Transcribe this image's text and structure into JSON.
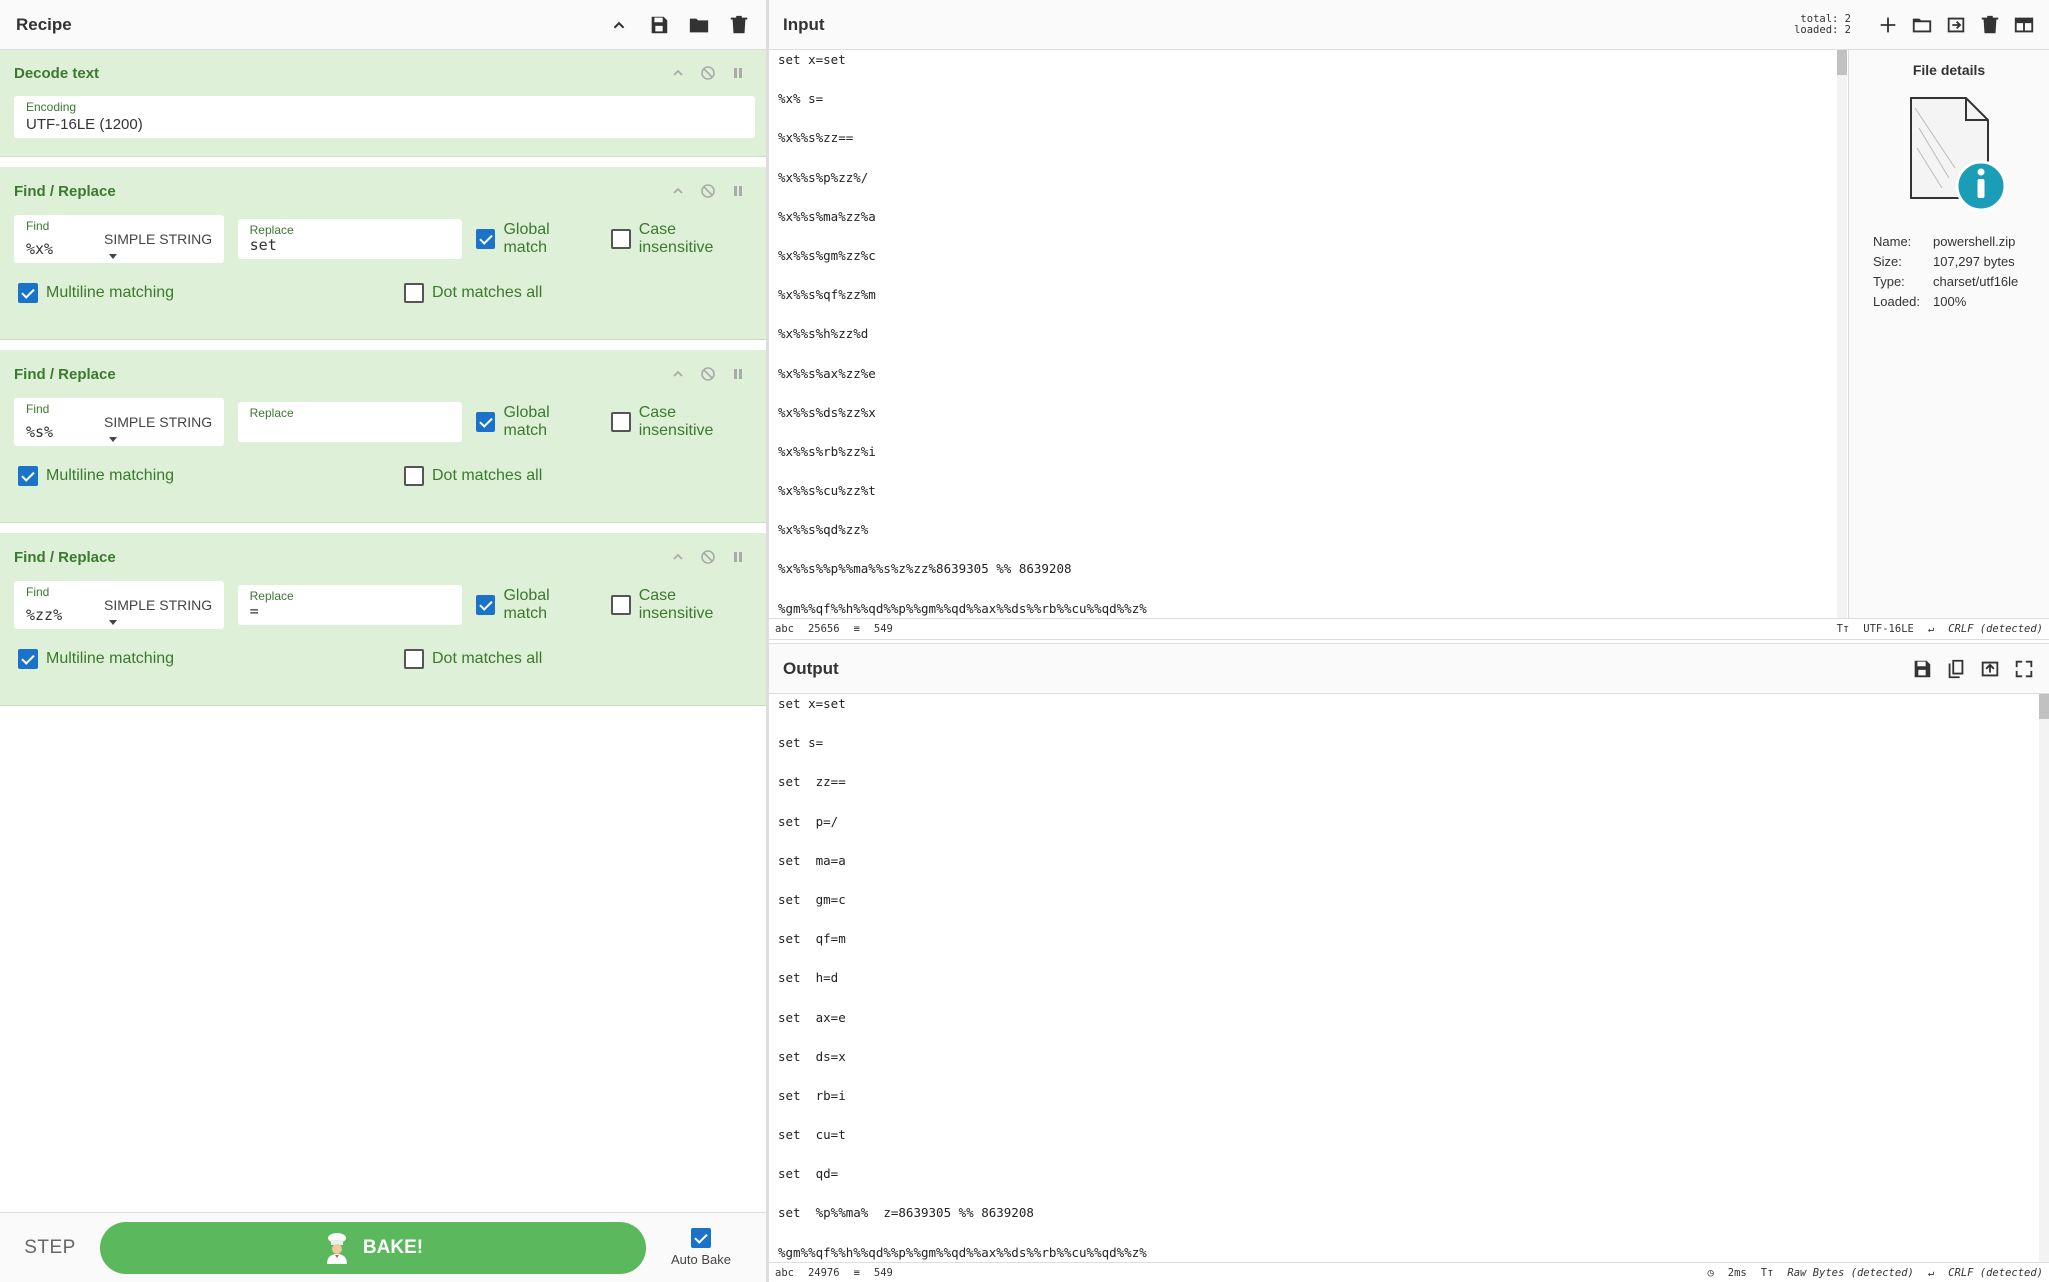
{
  "recipe": {
    "title": "Recipe",
    "operations": [
      {
        "name": "Decode text",
        "encoding_label": "Encoding",
        "encoding_value": "UTF-16LE (1200)"
      },
      {
        "name": "Find / Replace",
        "find_label": "Find",
        "find_value": "%x%",
        "find_type": "SIMPLE STRING",
        "replace_label": "Replace",
        "replace_value": "set",
        "global_match": "Global match",
        "case_insensitive": "Case insensitive",
        "multiline": "Multiline matching",
        "dot_all": "Dot matches all"
      },
      {
        "name": "Find / Replace",
        "find_label": "Find",
        "find_value": "%s%",
        "find_type": "SIMPLE STRING",
        "replace_label": "Replace",
        "replace_value": "",
        "global_match": "Global match",
        "case_insensitive": "Case insensitive",
        "multiline": "Multiline matching",
        "dot_all": "Dot matches all"
      },
      {
        "name": "Find / Replace",
        "find_label": "Find",
        "find_value": "%zz%",
        "find_type": "SIMPLE STRING",
        "replace_label": "Replace",
        "replace_value": "=",
        "global_match": "Global match",
        "case_insensitive": "Case insensitive",
        "multiline": "Multiline matching",
        "dot_all": "Dot matches all"
      }
    ],
    "controls": {
      "step": "STEP",
      "bake": "BAKE!",
      "auto_bake": "Auto Bake"
    }
  },
  "input": {
    "title": "Input",
    "total": "total:  2",
    "loaded": "loaded:  2",
    "lines": [
      "set x=set",
      "%x% s=",
      "%x%%s%zz==",
      "%x%%s%p%zz%/",
      "%x%%s%ma%zz%a",
      "%x%%s%gm%zz%c",
      "%x%%s%qf%zz%m",
      "%x%%s%h%zz%d",
      "%x%%s%ax%zz%e",
      "%x%%s%ds%zz%x",
      "%x%%s%rb%zz%i",
      "%x%%s%cu%zz%t",
      "%x%%s%qd%zz%",
      "%x%%s%%p%%ma%%s%z%zz%8639305 %% 8639208",
      "%gm%%qf%%h%%qd%%p%%gm%%qd%%ax%%ds%%rb%%cu%%qd%%z%"
    ],
    "status": {
      "chars": "25656",
      "lines": "549",
      "encoding": "UTF-16LE",
      "eol": "CRLF (detected)"
    }
  },
  "file_details": {
    "title": "File details",
    "name_label": "Name:",
    "name": "powershell.zip",
    "size_label": "Size:",
    "size": "107,297 bytes",
    "type_label": "Type:",
    "type": "charset/utf16le",
    "loaded_label": "Loaded:",
    "loaded": "100%"
  },
  "output": {
    "title": "Output",
    "lines": [
      "set x=set",
      "set s=",
      "set  zz==",
      "set  p=/",
      "set  ma=a",
      "set  gm=c",
      "set  qf=m",
      "set  h=d",
      "set  ax=e",
      "set  ds=x",
      "set  rb=i",
      "set  cu=t",
      "set  qd=",
      "set  %p%%ma%  z=8639305 %% 8639208",
      "%gm%%qf%%h%%qd%%p%%gm%%qd%%ax%%ds%%rb%%cu%%qd%%z%"
    ],
    "status": {
      "chars": "24976",
      "lines": "549",
      "time": "2ms",
      "encoding": "Raw Bytes (detected)",
      "eol": "CRLF (detected)"
    }
  },
  "colors": {
    "accent_green": "#5cb85c",
    "op_bg": "#dff0d8",
    "checkbox_blue": "#1a73c9"
  }
}
